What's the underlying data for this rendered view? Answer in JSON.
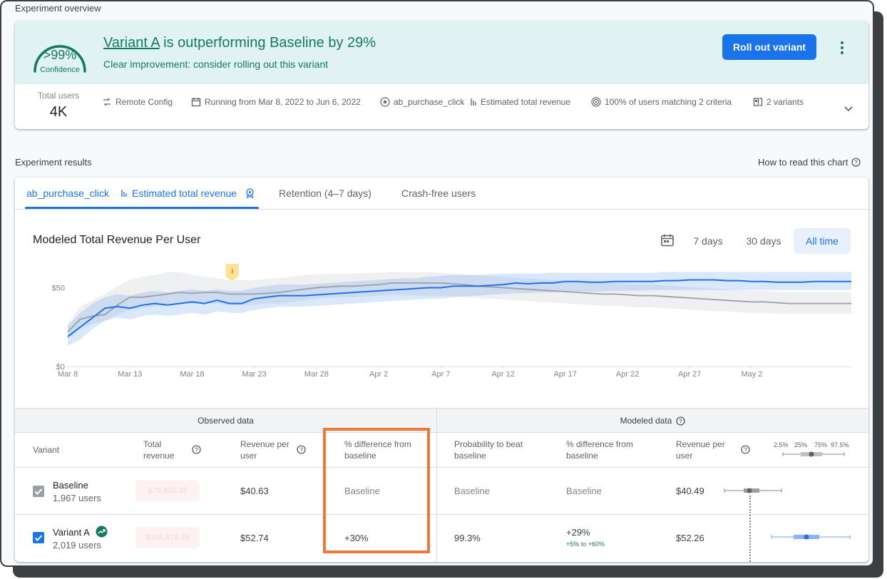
{
  "overview": {
    "section_title": "Experiment overview",
    "confidence": {
      "value": ">99%",
      "label": "Confidence",
      "level": 0.99
    },
    "headline": {
      "variant": "Variant A",
      "rest": " is outperforming Baseline by 29%"
    },
    "subline": "Clear improvement: consider rolling out this variant",
    "rollout_button": "Roll out variant",
    "total_users_label": "Total users",
    "total_users_value": "4K",
    "meta": [
      {
        "icon": "remote-config-icon",
        "text": "Remote Config"
      },
      {
        "icon": "calendar-icon",
        "text": "Running from Mar 8, 2022 to Jun 6, 2022"
      },
      {
        "icon": "star-circle-icon",
        "text": "ab_purchase_click"
      },
      {
        "icon": "metric-icon",
        "text": "Estimated total revenue"
      },
      {
        "icon": "target-icon",
        "text": "100% of users matching 2 criteria"
      },
      {
        "icon": "variants-icon",
        "text": "2 variants"
      }
    ]
  },
  "results": {
    "section_title": "Experiment results",
    "help_link": "How to read this chart",
    "tabs": [
      {
        "label": "ab_purchase_click",
        "active": true
      },
      {
        "label": "Estimated total revenue",
        "active": true
      },
      {
        "label": "Retention (4–7 days)",
        "active": false
      },
      {
        "label": "Crash-free users",
        "active": false
      }
    ],
    "chart_title": "Modeled Total Revenue Per User",
    "ranges": [
      "7 days",
      "30 days",
      "All time"
    ],
    "selected_range": "All time",
    "marker": "i"
  },
  "chart_data": {
    "type": "line",
    "title": "Modeled Total Revenue Per User",
    "xlabel": "",
    "ylabel": "",
    "x_ticks": [
      "Mar 8",
      "Mar 13",
      "Mar 18",
      "Mar 23",
      "Mar 28",
      "Apr 2",
      "Apr 7",
      "Apr 12",
      "Apr 17",
      "Apr 22",
      "Apr 27",
      "May 2"
    ],
    "y_ticks": [
      "$0",
      "$50"
    ],
    "ylim": [
      0,
      62
    ],
    "grid": false,
    "x": [
      0,
      1,
      2,
      3,
      4,
      5,
      6,
      7,
      8,
      9,
      10,
      11,
      12,
      13,
      14,
      15,
      16,
      17,
      18,
      19,
      20,
      21,
      22,
      23,
      24,
      25,
      26,
      27,
      28,
      29,
      30,
      31,
      32,
      33,
      34,
      35,
      36,
      37,
      38,
      39,
      40,
      41,
      42,
      43,
      44,
      45,
      46,
      47,
      48,
      49,
      50,
      51,
      52,
      53,
      54,
      55,
      56,
      57,
      58,
      59,
      60,
      61,
      62,
      63
    ],
    "series": [
      {
        "name": "Variant A",
        "color": "#1a73e8",
        "values": [
          19,
          25,
          31,
          37,
          38,
          37,
          39,
          40,
          39,
          40,
          41,
          40,
          42,
          40,
          40,
          43,
          44,
          45,
          45,
          45,
          45.5,
          46,
          46.5,
          47,
          47.5,
          48,
          48.5,
          49,
          49.5,
          50,
          50,
          51,
          51,
          51,
          51.5,
          52,
          53,
          52.5,
          53,
          53,
          54,
          54,
          53.5,
          53.5,
          54,
          54,
          54,
          54,
          54.5,
          54.5,
          55,
          55,
          55,
          54.5,
          54.5,
          54,
          54,
          53.5,
          53.5,
          53.5,
          54,
          54,
          54,
          54
        ],
        "band_low": [
          13,
          17,
          24,
          29,
          31,
          30,
          32,
          33,
          32,
          33,
          34,
          33,
          35,
          34,
          34,
          36,
          37,
          38,
          38,
          38,
          38.5,
          39,
          39.5,
          40,
          40.5,
          41,
          41.5,
          42,
          42.5,
          43,
          43,
          44,
          44.5,
          45,
          45.5,
          46,
          46.5,
          46.5,
          47,
          47,
          47.5,
          47.5,
          47.5,
          47.5,
          48,
          48,
          48,
          48.5,
          48.5,
          48.5,
          48.5,
          48.5,
          48.5,
          48.5,
          48.5,
          48.5,
          48.5,
          48.5,
          48.5,
          48.5,
          48.5,
          48.5,
          48.5,
          48.5
        ],
        "band_high": [
          26,
          34,
          40,
          44,
          46,
          45,
          47,
          48,
          47,
          48,
          49,
          48,
          49,
          48,
          48,
          50,
          51,
          52,
          52,
          52,
          52.5,
          53,
          53.5,
          54,
          54.5,
          55,
          55.5,
          56,
          56,
          57,
          57.5,
          58,
          58,
          58,
          58.5,
          59,
          59,
          59,
          59,
          59.5,
          59.5,
          59.5,
          59.5,
          59.5,
          59.5,
          59.5,
          59.5,
          59.5,
          60,
          60,
          60,
          60,
          60,
          60,
          60,
          60,
          60,
          60,
          60,
          60,
          60,
          60,
          60,
          60
        ]
      },
      {
        "name": "Baseline",
        "color": "#9aa0a6",
        "values": [
          22,
          30,
          32,
          33,
          39,
          44,
          44,
          45,
          46,
          47,
          46.5,
          47,
          47,
          46,
          46,
          46,
          46.5,
          47,
          48,
          49,
          50,
          50.5,
          51,
          51,
          51.5,
          52,
          53,
          53,
          53,
          53,
          53,
          52.5,
          52,
          51,
          50.5,
          50,
          49.5,
          49,
          48.5,
          48,
          47.5,
          47,
          46.5,
          46,
          46,
          45.5,
          45,
          45,
          44.5,
          44,
          43.5,
          43,
          42.5,
          42,
          41.5,
          41,
          41,
          40.5,
          40,
          40,
          40,
          40,
          40,
          40
        ],
        "band_low": [
          17,
          24,
          27,
          29,
          33,
          36,
          37,
          38,
          39,
          40,
          40,
          40,
          40,
          39,
          39,
          39,
          40,
          40,
          41,
          42,
          43,
          43.5,
          44,
          44,
          44.5,
          45,
          45.5,
          45,
          45,
          45,
          45,
          44.5,
          44,
          43.5,
          43,
          42.5,
          42,
          41.5,
          41,
          40.5,
          40,
          39.5,
          39,
          38.5,
          38.5,
          38,
          37.5,
          37.5,
          37,
          36.5,
          36,
          35.5,
          35,
          35,
          34.5,
          34,
          34,
          33.5,
          33.5,
          33.5,
          33.5,
          33.5,
          33.5,
          33.5
        ],
        "band_high": [
          27,
          38,
          42,
          46,
          51,
          55,
          57,
          58,
          60,
          60,
          58,
          57,
          56,
          55,
          55,
          55,
          55.5,
          56,
          57,
          58,
          58.5,
          59,
          59,
          59,
          59.5,
          59.5,
          60,
          60,
          60,
          60,
          59.5,
          59,
          58.5,
          58,
          57.5,
          57,
          56.5,
          56,
          55.5,
          55,
          54.5,
          54,
          53.5,
          53,
          53,
          52.5,
          52,
          52,
          51.5,
          51,
          50.5,
          50,
          49.5,
          49,
          48.5,
          48,
          48,
          47.5,
          47,
          47,
          47,
          47,
          47,
          47
        ]
      }
    ]
  },
  "table": {
    "observed_header": "Observed data",
    "modeled_header": "Modeled data",
    "columns": {
      "variant": "Variant",
      "total_revenue": "Total revenue",
      "revenue_per_user": "Revenue per user",
      "pct_diff_observed": "% difference from baseline",
      "prob_beat": "Probability to beat baseline",
      "pct_diff_modeled": "% difference from baseline",
      "modeled_rpu": "Revenue per user"
    },
    "percentile_labels": [
      "2.5%",
      "25%",
      "75%",
      "97.5%"
    ],
    "rows": [
      {
        "name": "Baseline",
        "users": "1,967 users",
        "total_revenue": "$79,922.32",
        "revenue_per_user": "$40.63",
        "pct_diff": "Baseline",
        "prob_beat": "Baseline",
        "pct_diff_modeled": "Baseline",
        "pct_range_low": "",
        "pct_range_mid": "",
        "pct_range_high": "",
        "modeled_rpu": "$40.49",
        "checked_color": "#9aa0a6"
      },
      {
        "name": "Variant A",
        "users": "2,019 users",
        "total_revenue": "$106,476.59",
        "revenue_per_user": "$52.74",
        "pct_diff": "+30%",
        "prob_beat": "99.3%",
        "pct_diff_modeled": "+29%",
        "pct_range_low": "+5%",
        "pct_range_mid": " to ",
        "pct_range_high": "+60%",
        "modeled_rpu": "$52.26",
        "checked_color": "#1a73e8"
      }
    ]
  }
}
